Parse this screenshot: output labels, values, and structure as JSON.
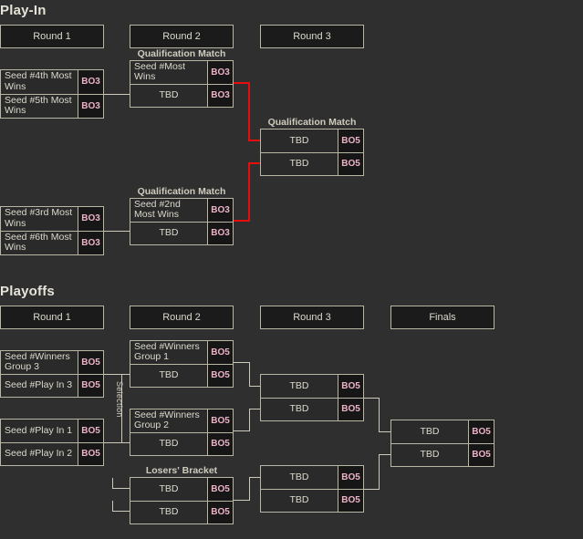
{
  "theme": {
    "background": "#2f2f2f",
    "box_background": "#2a2a2a",
    "header_background": "#1b1b1b",
    "badge_background": "#161616",
    "border": "#b9b6a4",
    "text": "#dcdacd",
    "badge_text": "#edb2c6",
    "connector": "#cdcabb",
    "connector_highlight": "#e50d0d"
  },
  "sections": [
    {
      "id": "play-in",
      "title": "Play-In",
      "round_headers": [
        {
          "label": "Round 1"
        },
        {
          "label": "Round 2"
        },
        {
          "label": "Round 3"
        }
      ],
      "captions": [
        {
          "label": "Qualification Match"
        },
        {
          "label": "Qualification Match"
        },
        {
          "label": "Qualification Match"
        }
      ],
      "matches": [
        {
          "id": "pi-r1-m1",
          "slots": [
            {
              "team": "Seed #4th Most Wins",
              "bo": "BO3",
              "align": "left"
            },
            {
              "team": "Seed #5th Most Wins",
              "bo": "BO3",
              "align": "left"
            }
          ]
        },
        {
          "id": "pi-r1-m2",
          "slots": [
            {
              "team": "Seed #3rd Most Wins",
              "bo": "BO3",
              "align": "left"
            },
            {
              "team": "Seed #6th Most Wins",
              "bo": "BO3",
              "align": "left"
            }
          ]
        },
        {
          "id": "pi-r2-m1",
          "caption": "Qualification Match",
          "slots": [
            {
              "team": "Seed #Most Wins",
              "bo": "BO3",
              "align": "left"
            },
            {
              "team": "TBD",
              "bo": "BO3",
              "align": "center"
            }
          ]
        },
        {
          "id": "pi-r2-m2",
          "caption": "Qualification Match",
          "slots": [
            {
              "team": "Seed #2nd Most Wins",
              "bo": "BO3",
              "align": "left"
            },
            {
              "team": "TBD",
              "bo": "BO3",
              "align": "center"
            }
          ]
        },
        {
          "id": "pi-r3-m1",
          "caption": "Qualification Match",
          "slots": [
            {
              "team": "TBD",
              "bo": "BO5",
              "align": "center"
            },
            {
              "team": "TBD",
              "bo": "BO5",
              "align": "center"
            }
          ]
        }
      ]
    },
    {
      "id": "playoffs",
      "title": "Playoffs",
      "round_headers": [
        {
          "label": "Round 1"
        },
        {
          "label": "Round 2"
        },
        {
          "label": "Round 3"
        },
        {
          "label": "Finals"
        }
      ],
      "selection_label": "Selection",
      "losers_bracket_caption": "Losers' Bracket",
      "matches": [
        {
          "id": "po-r1-m1",
          "slots": [
            {
              "team": "Seed #Winners Group 3",
              "bo": "BO5",
              "align": "left"
            },
            {
              "team": "Seed #Play In 3",
              "bo": "BO5",
              "align": "left"
            }
          ]
        },
        {
          "id": "po-r1-m2",
          "slots": [
            {
              "team": "Seed #Play In 1",
              "bo": "BO5",
              "align": "left"
            },
            {
              "team": "Seed #Play In 2",
              "bo": "BO5",
              "align": "left"
            }
          ]
        },
        {
          "id": "po-r2-m1",
          "slots": [
            {
              "team": "Seed #Winners Group 1",
              "bo": "BO5",
              "align": "left"
            },
            {
              "team": "TBD",
              "bo": "BO5",
              "align": "center"
            }
          ]
        },
        {
          "id": "po-r2-m2",
          "slots": [
            {
              "team": "Seed #Winners Group 2",
              "bo": "BO5",
              "align": "left"
            },
            {
              "team": "TBD",
              "bo": "BO5",
              "align": "center"
            }
          ]
        },
        {
          "id": "po-r2-m3",
          "caption": "Losers' Bracket",
          "slots": [
            {
              "team": "TBD",
              "bo": "BO5",
              "align": "center"
            },
            {
              "team": "TBD",
              "bo": "BO5",
              "align": "center"
            }
          ]
        },
        {
          "id": "po-r3-m1",
          "slots": [
            {
              "team": "TBD",
              "bo": "BO5",
              "align": "center"
            },
            {
              "team": "TBD",
              "bo": "BO5",
              "align": "center"
            }
          ]
        },
        {
          "id": "po-r3-m2",
          "slots": [
            {
              "team": "TBD",
              "bo": "BO5",
              "align": "center"
            },
            {
              "team": "TBD",
              "bo": "BO5",
              "align": "center"
            }
          ]
        },
        {
          "id": "po-finals",
          "slots": [
            {
              "team": "TBD",
              "bo": "BO5",
              "align": "center"
            },
            {
              "team": "TBD",
              "bo": "BO5",
              "align": "center"
            }
          ]
        }
      ]
    }
  ]
}
